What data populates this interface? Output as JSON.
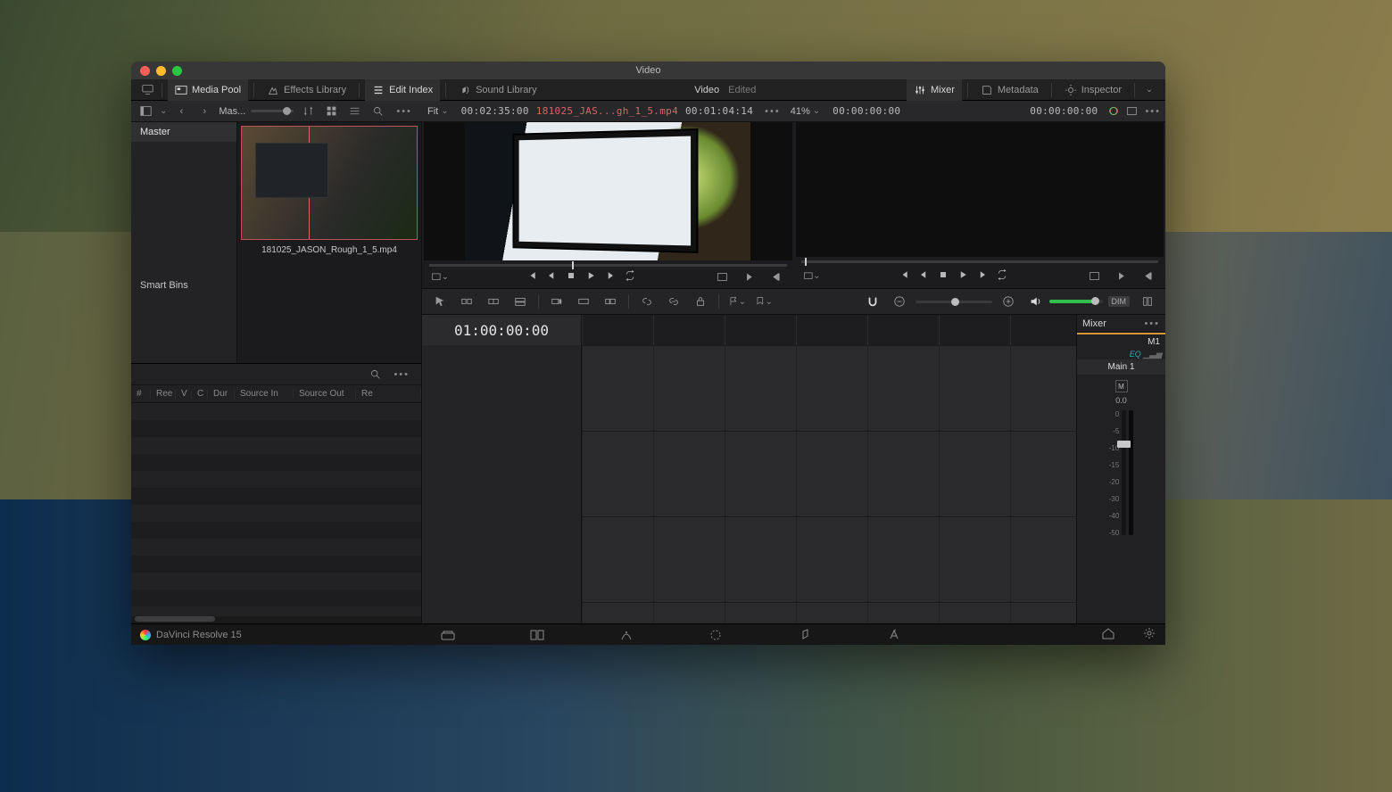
{
  "window": {
    "title": "Video"
  },
  "toolbar": {
    "workspaces": {
      "media_pool": "Media Pool",
      "effects_library": "Effects Library",
      "edit_index": "Edit Index",
      "sound_library": "Sound Library"
    },
    "center": {
      "title": "Video",
      "status": "Edited"
    },
    "right": {
      "mixer": "Mixer",
      "metadata": "Metadata",
      "inspector": "Inspector"
    }
  },
  "secbar": {
    "bin_label": "Mas...",
    "source": {
      "fit": "Fit",
      "duration": "00:02:35:00",
      "clipname": "181025_JAS...gh_1_5.mp4",
      "pos": "00:01:04:14"
    },
    "program": {
      "zoom": "41%",
      "tc_left": "00:00:00:00",
      "tc_right": "00:00:00:00"
    }
  },
  "media_pool": {
    "bins": {
      "master": "Master",
      "smart": "Smart Bins"
    },
    "clip": {
      "name": "181025_JASON_Rough_1_5.mp4"
    }
  },
  "edit_index": {
    "cols": [
      "#",
      "Ree",
      "V",
      "C",
      "Dur",
      "Source In",
      "Source Out",
      "Re"
    ]
  },
  "timeline": {
    "tc": "01:00:00:00"
  },
  "mixer": {
    "title": "Mixer",
    "strip": {
      "id": "M1",
      "eq": "EQ",
      "name": "Main 1",
      "mute": "M",
      "db": "0.0",
      "scale": [
        "0",
        "-5",
        "-10",
        "-15",
        "-20",
        "-30",
        "-40",
        "-50"
      ]
    }
  },
  "toolrow": {
    "dim": "DIM"
  },
  "bottom": {
    "brand": "DaVinci Resolve 15"
  }
}
